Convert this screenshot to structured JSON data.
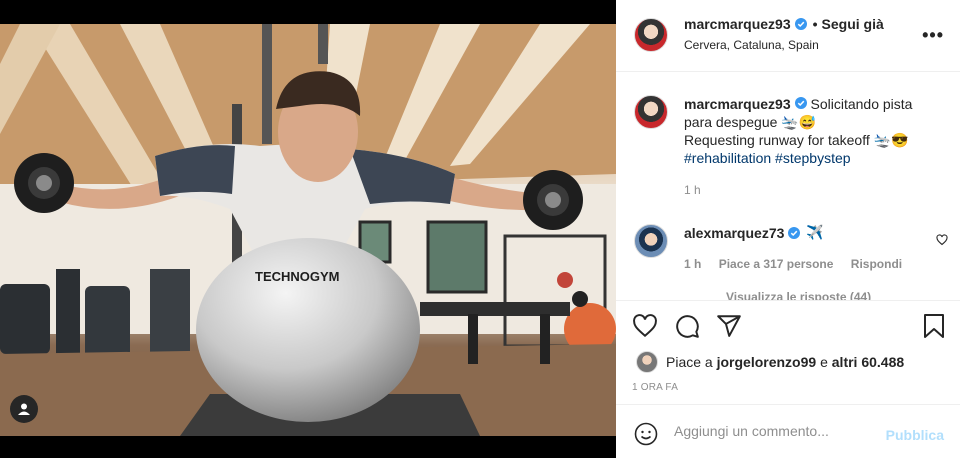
{
  "post": {
    "author": "marcmarquez93",
    "follow_status": "Segui già",
    "location": "Cervera, Cataluna, Spain",
    "caption_lines": [
      "Solicitando pista",
      "para despegue 🛬😅",
      "Requesting runway for takeoff 🛬😎"
    ],
    "hashtags": "#rehabilitation #stepbystep",
    "caption_age": "1 h",
    "photo_text": "TECHNOGYM"
  },
  "comments": [
    {
      "author": "alexmarquez73",
      "text": "✈️",
      "age": "1 h",
      "likes": "Piace a 317 persone",
      "reply_label": "Rispondi",
      "view_replies": "Visualizza le risposte (44)"
    }
  ],
  "actions": {
    "likes_prefix": "Piace a",
    "likes_user": "jorgelorenzo99",
    "likes_connector": "e",
    "likes_others": "altri 60.488",
    "timestamp": "1 ORA FA"
  },
  "composer": {
    "placeholder": "Aggiungi un commento...",
    "publish_label": "Pubblica"
  },
  "icons": {
    "more": "more-options-icon",
    "like": "heart-icon",
    "comment": "comment-icon",
    "share": "share-icon",
    "save": "bookmark-icon",
    "emoji": "emoji-icon",
    "tag": "user-tag-icon",
    "verified": "verified-badge-icon"
  },
  "colors": {
    "verified": "#3897f0",
    "link": "#00376b",
    "muted": "#8e8e8e",
    "publish_disabled": "#b2dffc"
  }
}
